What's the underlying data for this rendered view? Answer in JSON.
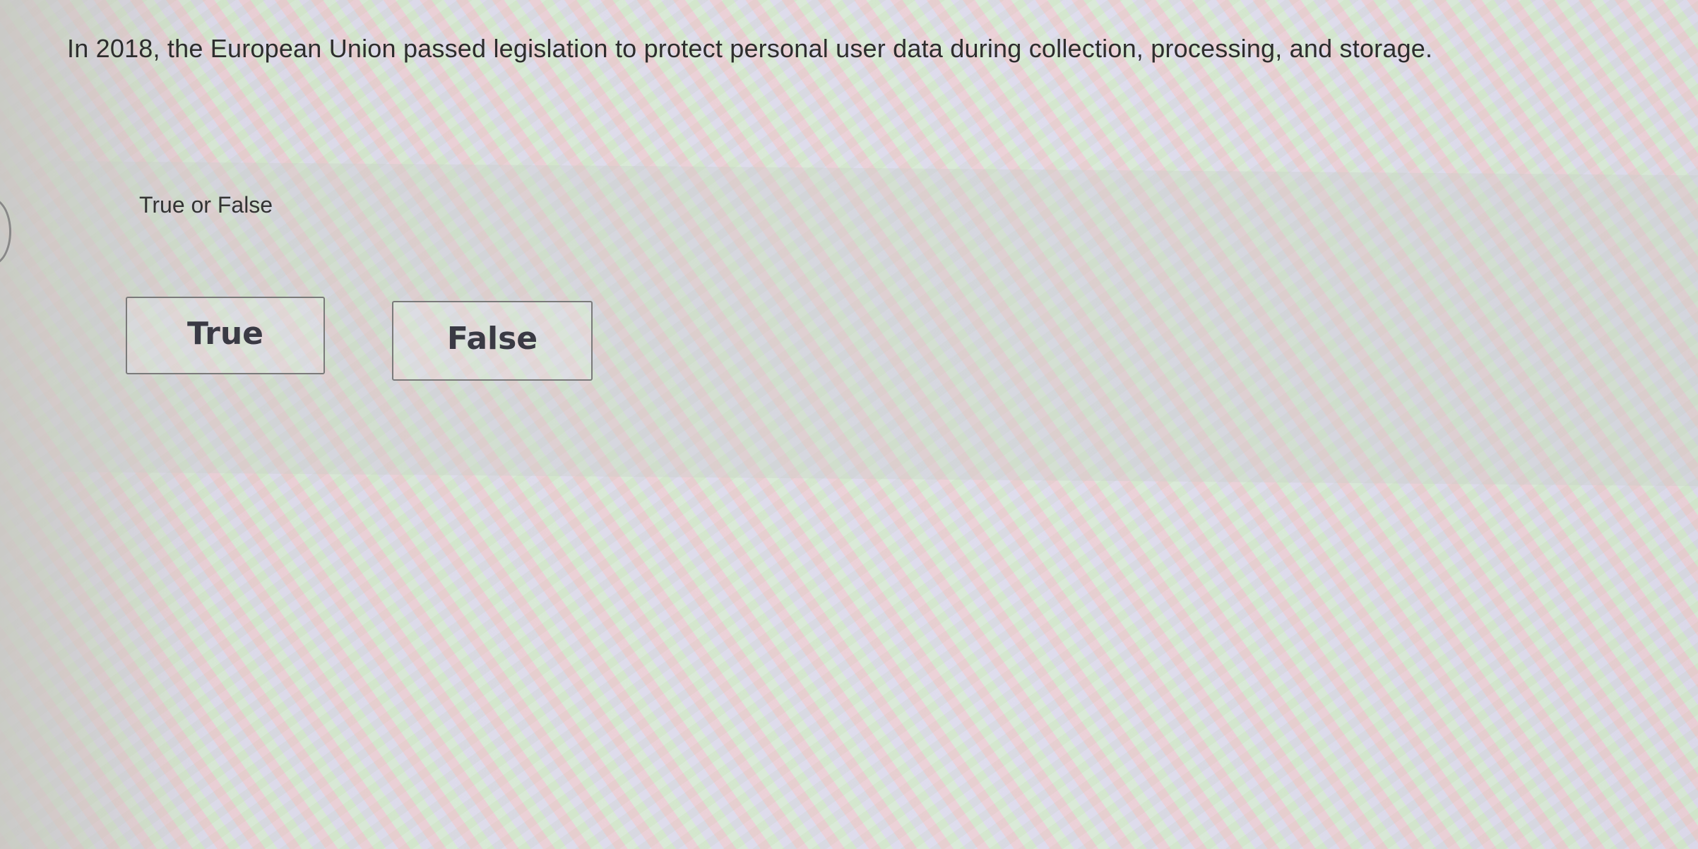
{
  "question": {
    "text": "In 2018, the European Union passed legislation to protect personal user data during collection, processing, and storage."
  },
  "answer_area": {
    "type_label": "True or False",
    "choices": [
      {
        "label": "True"
      },
      {
        "label": "False"
      }
    ]
  }
}
